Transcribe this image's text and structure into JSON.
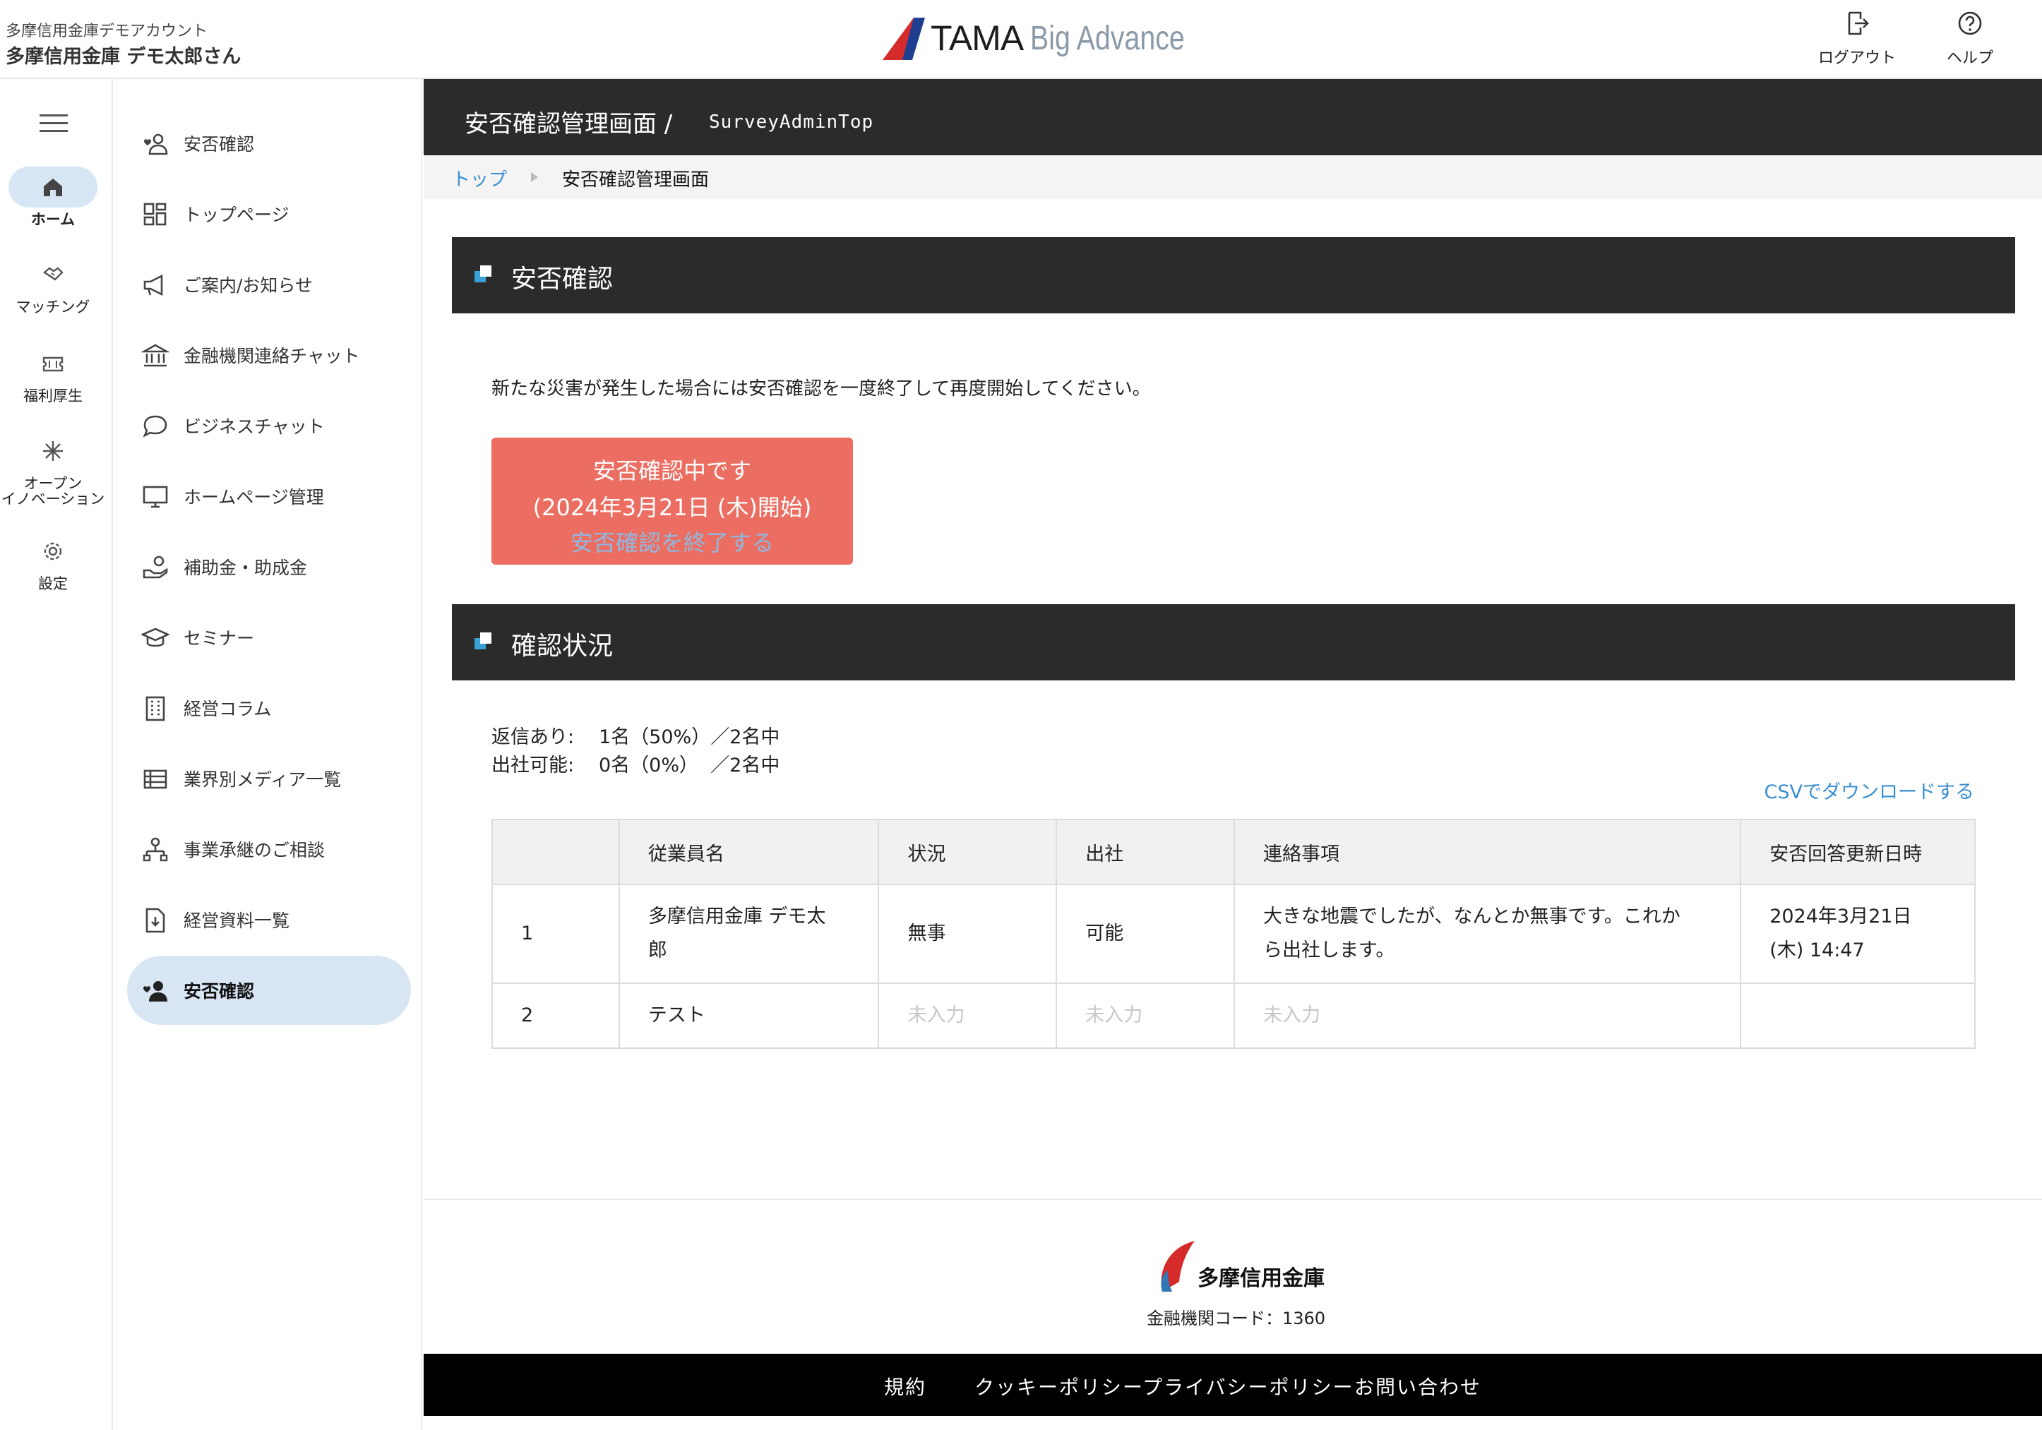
{
  "header": {
    "account_sub": "多摩信用金庫デモアカウント",
    "account_name": "多摩信用金庫 デモ太郎さん",
    "logo_tama": "TAMA",
    "logo_big_advance": "Big Advance",
    "logout_label": "ログアウト",
    "help_label": "ヘルプ"
  },
  "rail": {
    "items": [
      {
        "label": "ホーム",
        "icon": "home-icon"
      },
      {
        "label": "マッチング",
        "icon": "handshake-icon"
      },
      {
        "label": "福利厚生",
        "icon": "ticket-icon"
      },
      {
        "label_line1": "オープン",
        "label_line2": "イノベーション",
        "icon": "sparkle-icon"
      },
      {
        "label": "設定",
        "icon": "gear-icon"
      }
    ]
  },
  "sidebar": {
    "items": [
      {
        "label": "安否確認",
        "icon": "user-heart-icon"
      },
      {
        "label": "トップページ",
        "icon": "dashboard-icon"
      },
      {
        "label": "ご案内/お知らせ",
        "icon": "megaphone-icon"
      },
      {
        "label": "金融機関連絡チャット",
        "icon": "bank-icon"
      },
      {
        "label": "ビジネスチャット",
        "icon": "chat-bubble-icon"
      },
      {
        "label": "ホームページ管理",
        "icon": "monitor-icon"
      },
      {
        "label": "補助金・助成金",
        "icon": "hand-coin-icon"
      },
      {
        "label": "セミナー",
        "icon": "graduation-cap-icon"
      },
      {
        "label": "経営コラム",
        "icon": "building-icon"
      },
      {
        "label": "業界別メディア一覧",
        "icon": "list-icon"
      },
      {
        "label": "事業承継のご相談",
        "icon": "succession-icon"
      },
      {
        "label": "経営資料一覧",
        "icon": "document-download-icon"
      },
      {
        "label": "安否確認",
        "icon": "user-heart-filled-icon"
      }
    ]
  },
  "page": {
    "title": "安否確認管理画面 /",
    "route": "SurveyAdminTop",
    "breadcrumb_home": "トップ",
    "breadcrumb_current": "安否確認管理画面"
  },
  "safety": {
    "section_title": "安否確認",
    "notice": "新たな災害が発生した場合には安否確認を一度終了して再度開始してください。",
    "button_line1": "安否確認中です",
    "button_line2": "(2024年3月21日 (木)開始)",
    "button_line3": "安否確認を終了する"
  },
  "status": {
    "section_title": "確認状況",
    "reply_label": "返信あり:",
    "reply_value": "1名（50%）／2名中",
    "attend_label": "出社可能:",
    "attend_value": "0名（0%）  ／2名中",
    "csv_link": "CSVでダウンロードする",
    "columns": [
      "",
      "従業員名",
      "状況",
      "出社",
      "連絡事項",
      "安否回答更新日時"
    ],
    "rows": [
      {
        "no": "1",
        "name_line1": "多摩信用金庫 デモ太",
        "name_line2": "郎",
        "status": "無事",
        "attend": "可能",
        "note_line1": "大きな地震でしたが、なんとか無事です。これか",
        "note_line2": "ら出社します。",
        "updated_line1": "2024年3月21日",
        "updated_line2": "(木) 14:47"
      },
      {
        "no": "2",
        "name": "テスト",
        "status": "未入力",
        "attend": "未入力",
        "note": "未入力",
        "updated": ""
      }
    ]
  },
  "footer": {
    "bank_name": "多摩信用金庫",
    "bank_code": "金融機関コード：1360",
    "links": [
      "規約",
      "クッキーポリシー",
      "プライバシーポリシー",
      "お問い合わせ"
    ]
  },
  "colors": {
    "accent_blue": "#3b8fd0",
    "button_red": "#ec6e62",
    "dark_bar": "#2b2b2b",
    "active_bg": "#d8e6f4"
  }
}
